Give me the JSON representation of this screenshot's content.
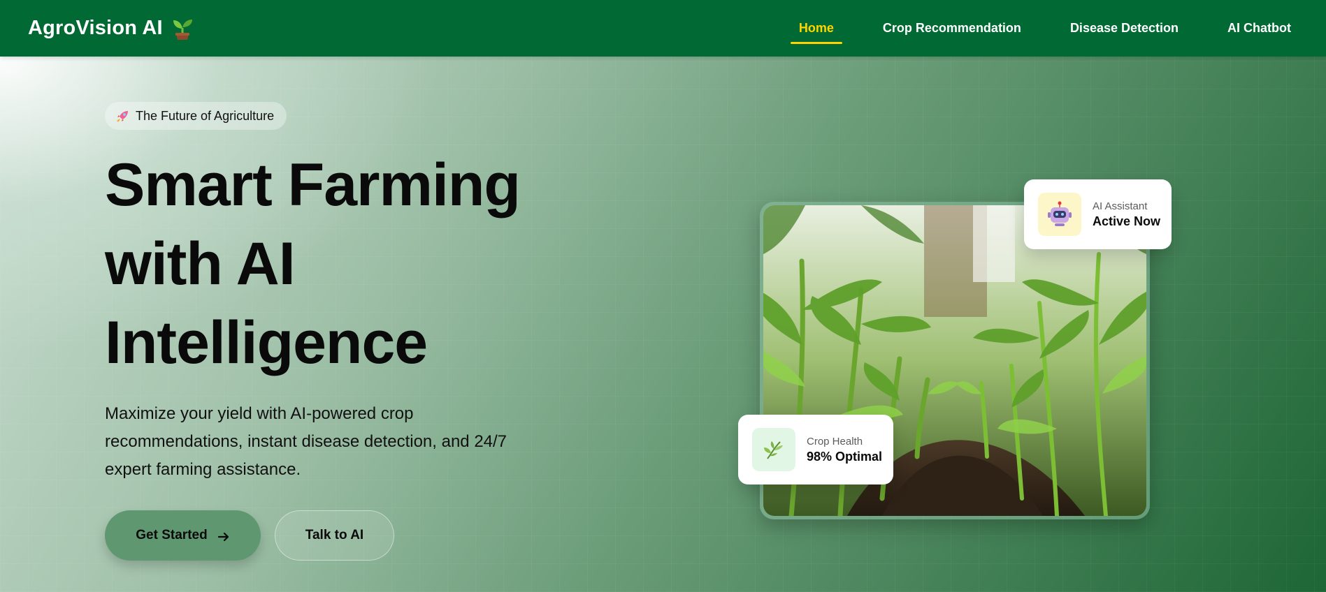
{
  "navbar": {
    "brand": "AgroVision AI",
    "brand_icon": "seedling-icon",
    "links": [
      {
        "label": "Home",
        "active": true
      },
      {
        "label": "Crop Recommendation",
        "active": false
      },
      {
        "label": "Disease Detection",
        "active": false
      },
      {
        "label": "AI Chatbot",
        "active": false
      }
    ]
  },
  "hero": {
    "badge": {
      "icon": "rocket-icon",
      "text": "The Future of Agriculture"
    },
    "headline": [
      "Smart Farming",
      "with AI",
      "Intelligence"
    ],
    "description": "Maximize your yield with AI-powered crop recommendations, instant disease detection, and 24/7 expert farming assistance.",
    "primary_button": {
      "label": "Get Started",
      "icon": "arrow-right-icon"
    },
    "secondary_button": {
      "label": "Talk to AI"
    },
    "image": {
      "subject": "corn-field-photo"
    },
    "ai_card": {
      "icon": "robot-icon",
      "label": "AI Assistant",
      "value": "Active Now"
    },
    "health_card": {
      "icon": "herb-icon",
      "label": "Crop Health",
      "value": "98% Optimal"
    }
  },
  "colors": {
    "navbar_bg": "#006934",
    "nav_active": "#ffd400",
    "primary_button": "#5f9870",
    "text_dark": "#0a0a0a"
  }
}
